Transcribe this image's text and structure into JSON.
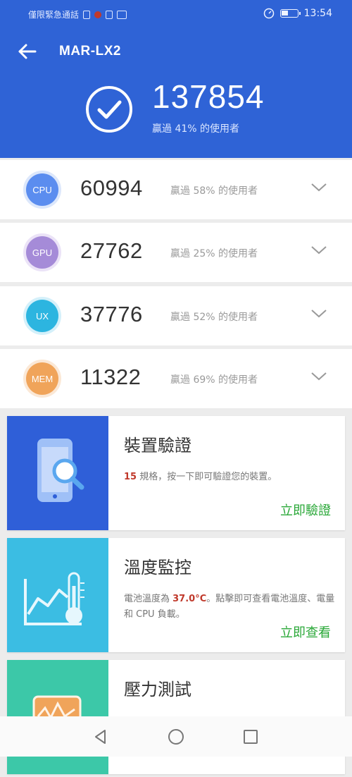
{
  "status_bar": {
    "carrier_text": "僅限緊急通話",
    "time": "13:54"
  },
  "header": {
    "device_name": "MAR-LX2",
    "total_score": "137854",
    "total_sub": "贏過 41% 的使用者"
  },
  "scores": [
    {
      "label": "CPU",
      "score": "60994",
      "percent_text": "贏過 58% 的使用者",
      "color": "#5b8def"
    },
    {
      "label": "GPU",
      "score": "27762",
      "percent_text": "贏過 25% 的使用者",
      "color": "#a58bd8"
    },
    {
      "label": "UX",
      "score": "37776",
      "percent_text": "贏過 52% 的使用者",
      "color": "#2cb5e0"
    },
    {
      "label": "MEM",
      "score": "11322",
      "percent_text": "贏過 69% 的使用者",
      "color": "#f0a45a"
    }
  ],
  "cards": {
    "verify": {
      "title": "裝置驗證",
      "desc_highlight": "15",
      "desc_text": " 規格，按一下即可驗證您的裝置。",
      "action": "立即驗證",
      "color": "#2f5fd8"
    },
    "temperature": {
      "title": "溫度監控",
      "desc_prefix": "電池溫度為 ",
      "desc_highlight": "37.0°C",
      "desc_text": "。點擊即可查看電池溫度、電量和 CPU 負載。",
      "action": "立即查看",
      "color": "#3bbde3"
    },
    "stress": {
      "title": "壓力測試",
      "color": "#3cc8a8"
    }
  },
  "icons": [
    "back-arrow-icon",
    "check-icon",
    "chevron-down-icon",
    "phone-search-icon",
    "thermometer-chart-icon",
    "chip-icon",
    "nav-back-icon",
    "nav-home-icon",
    "nav-recents-icon"
  ]
}
